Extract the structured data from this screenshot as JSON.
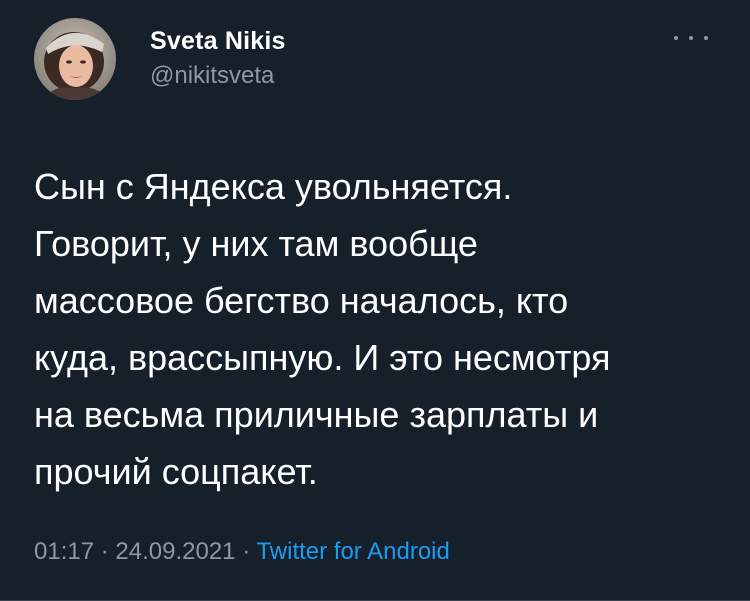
{
  "author": {
    "display_name": "Sveta Nikis",
    "handle": "@nikitsveta"
  },
  "more_menu_icon": "more-horizontal-icon",
  "body_lines": [
    "Сын с Яндекса увольняется.",
    "Говорит, у них там вообще",
    "массовое бегство началось, кто",
    "куда, врассыпную. И это несмотря",
    "на весьма приличные зарплаты и",
    "прочий соцпакет."
  ],
  "meta": {
    "time": "01:17",
    "separator": "·",
    "date": "24.09.2021",
    "source": "Twitter for Android"
  },
  "colors": {
    "background": "#15202b",
    "primary_text": "#ffffff",
    "secondary_text": "#8b98a5",
    "link": "#1d9bf0"
  }
}
